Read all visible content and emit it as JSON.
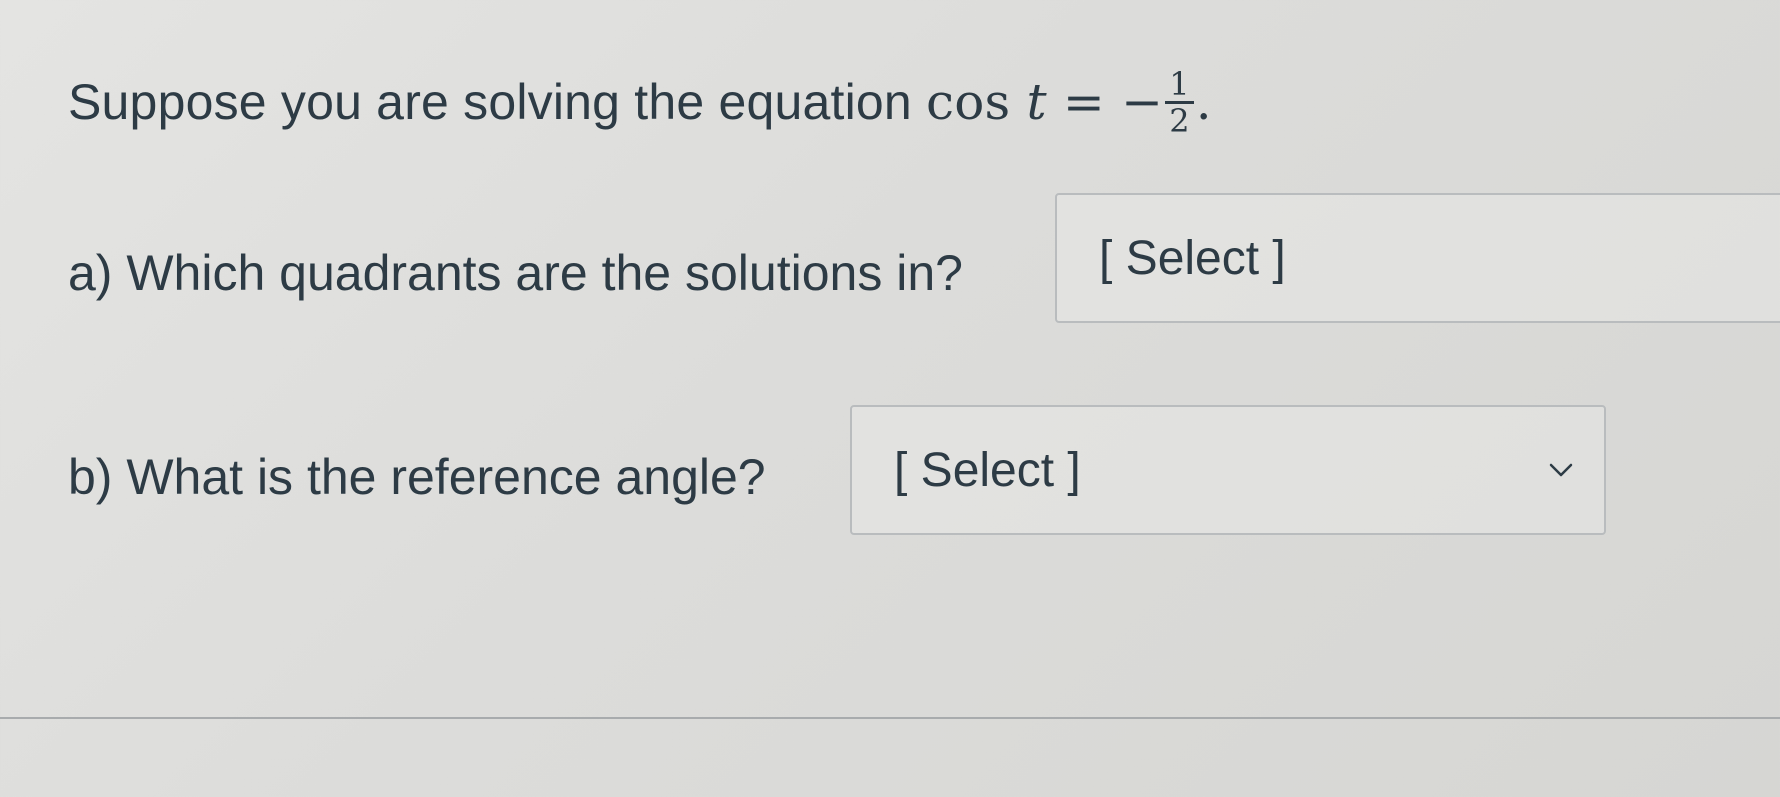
{
  "question": {
    "prompt": "Suppose you are solving the equation",
    "equation": {
      "func": "cos",
      "variable": "t",
      "equals": "=",
      "sign": "−",
      "numerator": "1",
      "denominator": "2",
      "end": "."
    }
  },
  "part_a": {
    "label": "a) Which quadrants are the solutions in?",
    "select_value": "[ Select ]"
  },
  "part_b": {
    "label": "b) What is the reference angle?",
    "select_value": "[ Select ]",
    "dropdown_icon": "chevron-down-icon"
  },
  "colors": {
    "text": "#2d3b45",
    "border": "#b9bcbe",
    "background": "#dedede"
  }
}
